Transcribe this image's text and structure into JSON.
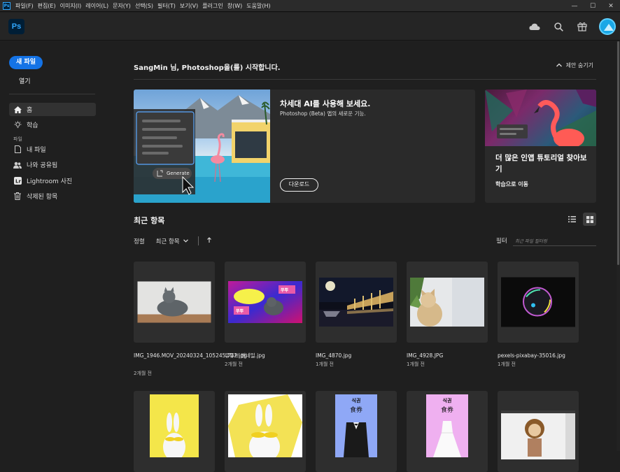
{
  "menu": [
    "파일(F)",
    "편집(E)",
    "이미지(I)",
    "레이어(L)",
    "문자(Y)",
    "선택(S)",
    "필터(T)",
    "보기(V)",
    "플러그인",
    "창(W)",
    "도움말(H)"
  ],
  "app_logo": "Ps",
  "menu_logo": "Ps",
  "window_controls": {
    "minimize": "—",
    "maximize": "☐",
    "close": "✕"
  },
  "sidebar": {
    "new_file": "새 파일",
    "open": "열기",
    "items": [
      {
        "label": "홈",
        "icon": "home-icon"
      },
      {
        "label": "학습",
        "icon": "lightbulb-icon"
      }
    ],
    "section_label": "파일",
    "file_items": [
      {
        "label": "내 파일",
        "icon": "file-icon"
      },
      {
        "label": "나와 공유됨",
        "icon": "shared-icon"
      },
      {
        "label": "Lightroom 사진",
        "icon": "lightroom-icon"
      },
      {
        "label": "삭제된 항목",
        "icon": "trash-icon"
      }
    ]
  },
  "main": {
    "greeting": "SangMin 님, Photoshop을(를) 시작합니다.",
    "hide_suggestions": "제안 숨기기",
    "banner": {
      "title": "차세대 AI를 사용해 보세요.",
      "subtitle": "Photoshop (Beta) 앱의 새로운 기능.",
      "button": "다운로드",
      "generate_label": "Generate"
    },
    "tutorial": {
      "title": "더 많은 인앱 튜토리얼 찾아보기",
      "link": "학습으로 이동"
    },
    "recent_title": "최근 항목",
    "sort_label": "정렬",
    "sort_value": "최근 항목",
    "filter_label": "필터",
    "filter_placeholder": "최근 파일 필터링"
  },
  "recent_files": [
    {
      "name": "IMG_1946.MOV_20240324_105245.732.jpg",
      "date": "2개월 전"
    },
    {
      "name": "유튜브 썸네일.jpg",
      "date": "2개월 전"
    },
    {
      "name": "IMG_4870.jpg",
      "date": "1개월 전"
    },
    {
      "name": "IMG_4928.JPG",
      "date": "1개월 전"
    },
    {
      "name": "pexels-pixabay-35016.jpg",
      "date": "1개월 전"
    }
  ],
  "thumb_text": {
    "ticket_word": "식권",
    "ticket_hanja": "食券",
    "thumb_words": [
      "쭈뿌",
      "쭈뿌"
    ]
  },
  "colors": {
    "accent": "#1473e6",
    "bg": "#1f1f1f",
    "card": "#2e2e2e"
  }
}
